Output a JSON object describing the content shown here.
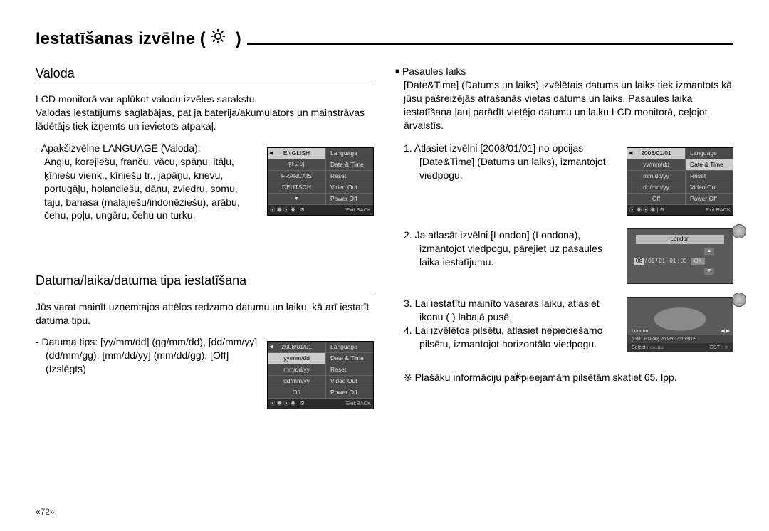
{
  "title": "Iestatīšanas izvēlne (",
  "title_close": ")",
  "pagenum": "«72»",
  "left": {
    "h1": "Valoda",
    "p1": "LCD monitorā var aplūkot valodu izvēles sarakstu.",
    "p2": "Valodas iestatījums saglabājas, pat ja baterija/akumulators un maiņstrāvas lādētājs tiek izņemts un ievietots atpakaļ.",
    "sub1": "- Apakšizvēlne LANGUAGE (Valoda):",
    "sub1b": "Angļu, korejiešu, franču, vācu, spāņu, itāļu, ķīniešu vienk., ķīniešu tr., japāņu, krievu, portugāļu, holandiešu, dāņu, zviedru, somu, taju, bahasa (malajiešu/indonēziešu), arābu, čehu, poļu, ungāru, čehu un turku.",
    "osd1": {
      "left": [
        "ENGLISH",
        "한국어",
        "FRANÇAIS",
        "DEUTSCH",
        "↓"
      ],
      "right": [
        "Language",
        "Date & Time",
        "Reset",
        "Video Out",
        "Power Off"
      ],
      "exit": "Exit:BACK",
      "sel_left": 0
    },
    "h2": "Datuma/laika/datuma tipa iestatīšana",
    "p3": "Jūs varat mainīt uzņemtajos attēlos redzamo datumu un laiku, kā arī iestatīt datuma tipu.",
    "sub2": "- Datuma tips: [yy/mm/dd] (gg/mm/dd), [dd/mm/yy] (dd/mm/gg), [mm/dd/yy] (mm/dd/gg), [Off] (Izslēgts)",
    "osd2": {
      "left": [
        "2008/01/01",
        "yy/mm/dd",
        "mm/dd/yy",
        "dd/mm/yy",
        "Off"
      ],
      "right": [
        "Language",
        "Date & Time",
        "Reset",
        "Video Out",
        "Power Off"
      ],
      "exit": "Exit:BACK",
      "sel_left": 1
    }
  },
  "right": {
    "bullet": "Pasaules laiks",
    "intro": "[Date&Time] (Datums un laiks) izvēlētais datums un laiks tiek izmantots kā jūsu pašreizējās atrašanās vietas datums un laiks. Pasaules laika iestatīšana ļauj parādīt vietējo datumu un laiku LCD monitorā, ceļojot ārvalstīs.",
    "step1": "1. Atlasiet izvēlni [2008/01/01] no opcijas [Date&Time] (Datums un laiks), izmantojot viedpogu.",
    "osd3": {
      "left": [
        "2008/01/01",
        "yy/mm/dd",
        "mm/dd/yy",
        "dd/mm/yy",
        "Off"
      ],
      "right": [
        "Language",
        "Date & Time",
        "Reset",
        "Video Out",
        "Power Off"
      ],
      "exit": "Exit:BACK",
      "sel_right": 1,
      "sel_left": 0
    },
    "step2": "2. Ja atlasāt izvēlni [London] (Londona), izmantojot viedpogu, pārejiet uz pasaules laika iestatījumu.",
    "panel2": {
      "london": "London",
      "d1": "08",
      "d2": "01",
      "d3": "01",
      "d4": "01",
      "d5": "00",
      "ok": "OK"
    },
    "step3": "3. Lai iestatītu mainīto vasaras laiku, atlasiet ikonu (        ) labajā pusē.",
    "step4": "4. Lai izvēlētos pilsētu, atlasiet nepieciešamo pilsētu,  izmantojot horizontālo viedpogu.",
    "note": "※ Plašāku informāciju par pieejamām pilsētām skatiet 65. lpp.",
    "panel3": {
      "london": "London",
      "gmt": "(GMT+09:00) 2008/01/01 09:05",
      "select": "Select :",
      "dst": "DST :"
    }
  }
}
